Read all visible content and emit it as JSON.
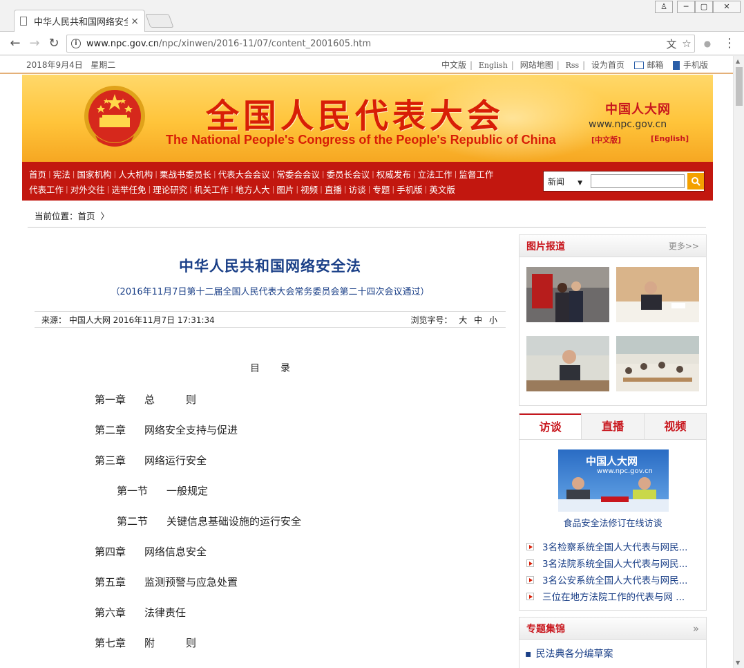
{
  "browser": {
    "tab_title": "中华人民共和国网络安全法",
    "tab_close": "×",
    "url_host": "www.npc.gov.cn",
    "url_path": "/npc/xinwen/2016-11/07/content_2001605.htm",
    "window_controls": {
      "user": "♙",
      "minimize": "─",
      "restore": "▢",
      "close": "✕"
    },
    "nav": {
      "back": "←",
      "forward": "→",
      "reload": "↻",
      "menu": "⋮"
    },
    "icons": {
      "info": "i",
      "translate": "文",
      "star": "☆",
      "extension": "●"
    }
  },
  "topbar": {
    "date": "2018年9月4日",
    "weekday": "星期二",
    "links": [
      "中文版",
      "English",
      "网站地图",
      "Rss",
      "设为首页"
    ],
    "mail": "邮箱",
    "mobile": "手机版"
  },
  "header": {
    "title": "全国人民代表大会",
    "subtitle": "The National People's Congress of the People's Republic of China",
    "logo_text": "中国人大网",
    "domain": "www.npc.gov.cn",
    "lang_cn": "[中文版]",
    "lang_en": "[English]"
  },
  "nav": {
    "row1": [
      "首页",
      "宪法",
      "国家机构",
      "人大机构",
      "栗战书委员长",
      "代表大会会议",
      "常委会会议",
      "委员长会议",
      "权威发布",
      "立法工作",
      "监督工作"
    ],
    "row2": [
      "代表工作",
      "对外交往",
      "选举任免",
      "理论研究",
      "机关工作",
      "地方人大",
      "图片",
      "视频",
      "直播",
      "访谈",
      "专题",
      "手机版",
      "英文版"
    ]
  },
  "search": {
    "selected": "新闻",
    "arrow": "▼",
    "input_value": ""
  },
  "breadcrumb": {
    "label": "当前位置：首页",
    "arrow": "〉"
  },
  "article": {
    "title": "中华人民共和国网络安全法",
    "subtitle": "（2016年11月7日第十二届全国人民代表大会常务委员会第二十四次会议通过）",
    "meta_source": "来源： 中国人大网 2016年11月7日 17:31:34",
    "font_size_label": "浏览字号：",
    "font_sizes": [
      "大",
      "中",
      "小"
    ],
    "toc_title": "目录",
    "toc": [
      {
        "level": 1,
        "chapter": "第一章",
        "title": "总　　　则"
      },
      {
        "level": 1,
        "chapter": "第二章",
        "title": "网络安全支持与促进"
      },
      {
        "level": 1,
        "chapter": "第三章",
        "title": "网络运行安全"
      },
      {
        "level": 2,
        "chapter": "第一节",
        "title": "一般规定"
      },
      {
        "level": 2,
        "chapter": "第二节",
        "title": "关键信息基础设施的运行安全"
      },
      {
        "level": 1,
        "chapter": "第四章",
        "title": "网络信息安全"
      },
      {
        "level": 1,
        "chapter": "第五章",
        "title": "监测预警与应急处置"
      },
      {
        "level": 1,
        "chapter": "第六章",
        "title": "法律责任"
      },
      {
        "level": 1,
        "chapter": "第七章",
        "title": "附　　　则"
      }
    ]
  },
  "sidebar": {
    "photo_section": {
      "title": "图片报道",
      "more": "更多>>"
    },
    "tabs": [
      "访谈",
      "直播",
      "视频"
    ],
    "interview": {
      "image_logo": "中国人大网",
      "image_domain": "www.npc.gov.cn",
      "caption": "食品安全法修订在线访谈"
    },
    "news": [
      "3名检察系统全国人大代表与网民...",
      "3名法院系统全国人大代表与网民...",
      "3名公安系统全国人大代表与网民...",
      "三位在地方法院工作的代表与网 ..."
    ],
    "special": {
      "title": "专题集锦",
      "more": "»",
      "items": [
        "民法典各分编草案"
      ]
    }
  },
  "colors": {
    "brand_red": "#c2170f",
    "title_blue": "#1a3f87",
    "header_gold": "#ffc43a"
  }
}
